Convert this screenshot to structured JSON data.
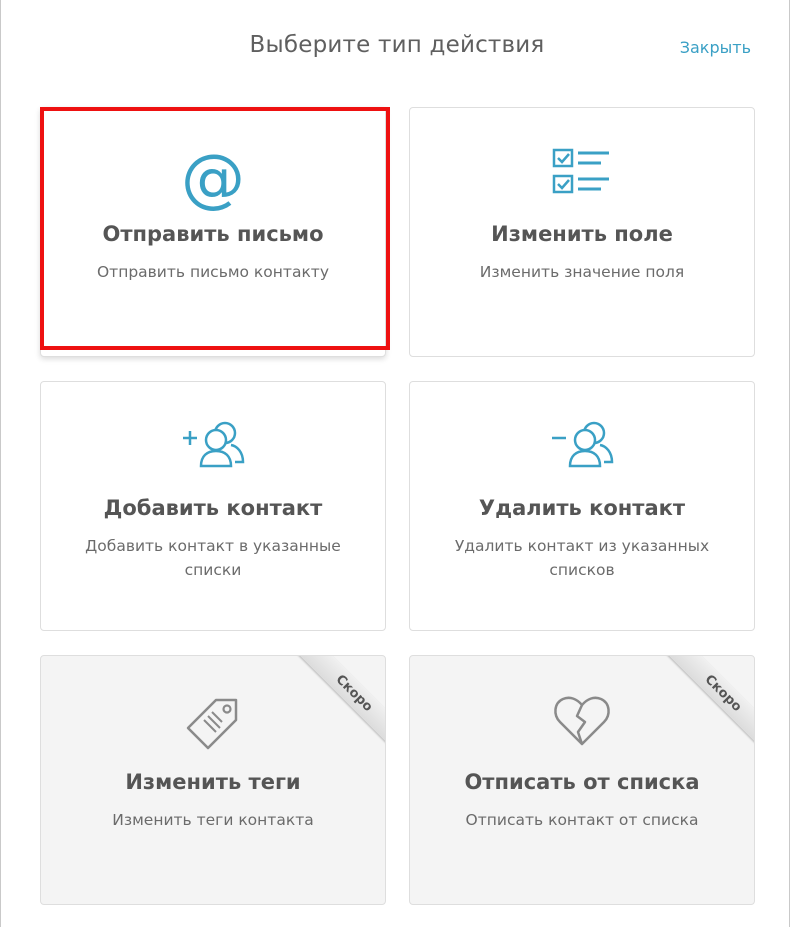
{
  "header": {
    "title": "Выберите тип действия",
    "close_label": "Закрыть"
  },
  "colors": {
    "accent": "#3aa0c5",
    "highlight": "#ee1111",
    "disabled_icon": "#8a8a8a"
  },
  "cards": [
    {
      "title": "Отправить письмо",
      "description": "Отправить письмо контакту",
      "icon": "at-sign-icon",
      "selected": true
    },
    {
      "title": "Изменить поле",
      "description": "Изменить значение поля",
      "icon": "checklist-icon"
    },
    {
      "title": "Добавить контакт",
      "description": "Добавить контакт в указанные списки",
      "icon": "add-users-icon"
    },
    {
      "title": "Удалить контакт",
      "description": "Удалить контакт из указанных списков",
      "icon": "remove-users-icon"
    },
    {
      "title": "Изменить теги",
      "description": "Изменить теги контакта",
      "icon": "tag-icon",
      "badge": "Скоро",
      "disabled": true
    },
    {
      "title": "Отписать от списка",
      "description": "Отписать контакт от списка",
      "icon": "broken-heart-icon",
      "badge": "Скоро",
      "disabled": true
    }
  ]
}
